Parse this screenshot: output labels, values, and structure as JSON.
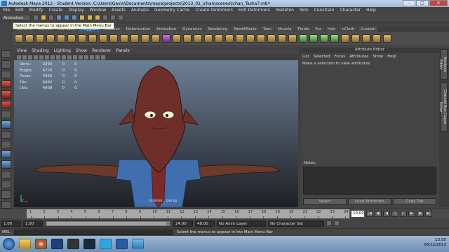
{
  "window": {
    "title": "Autodesk Maya 2012 - Student Version: C:\\Users\\Gavin\\Documents\\maya\\projects\\2013_01_ichan\\scenes\\Ichan_Tasha7.mb*"
  },
  "menubar": [
    "File",
    "Edit",
    "Modify",
    "Create",
    "Display",
    "Window",
    "Assets",
    "Animate",
    "Geometry Cache",
    "Create Deformers",
    "Edit Deformers",
    "Skeleton",
    "Skin",
    "Constrain",
    "Character",
    "Help"
  ],
  "status_line": {
    "mode": "Animation"
  },
  "tooltip": "Select the menus to appear in the Main Menu Bar",
  "shelf_tabs": [
    {
      "label": "General",
      "active": false
    },
    {
      "label": "Curves",
      "active": false
    },
    {
      "label": "Surfaces",
      "active": false
    },
    {
      "label": "Polygons",
      "active": true
    },
    {
      "label": "Subdivs",
      "active": false
    },
    {
      "label": "Deformation",
      "active": false
    },
    {
      "label": "Animation",
      "active": false
    },
    {
      "label": "Dynamics",
      "active": false
    },
    {
      "label": "Rendering",
      "active": false
    },
    {
      "label": "PaintEffects",
      "active": false
    },
    {
      "label": "Toon",
      "active": false
    },
    {
      "label": "Muscle",
      "active": false
    },
    {
      "label": "Fluids",
      "active": false
    },
    {
      "label": "Fur",
      "active": false
    },
    {
      "label": "Hair",
      "active": false
    },
    {
      "label": "nCloth",
      "active": false
    },
    {
      "label": "Custom",
      "active": false
    }
  ],
  "panel_menu": [
    "View",
    "Shading",
    "Lighting",
    "Show",
    "Renderer",
    "Panels"
  ],
  "hud": [
    {
      "label": "Verts:",
      "v1": "3290",
      "v2": "0",
      "v3": "0"
    },
    {
      "label": "Edges:",
      "v1": "6776",
      "v2": "0",
      "v3": "0"
    },
    {
      "label": "Faces:",
      "v1": "3456",
      "v2": "0",
      "v3": "0"
    },
    {
      "label": "Tris:",
      "v1": "6490",
      "v2": "0",
      "v3": "0"
    },
    {
      "label": "UVs:",
      "v1": "4008",
      "v2": "0",
      "v3": "0"
    }
  ],
  "camera_label": "rotatek : persp",
  "attribute_editor": {
    "header": "Attribute Editor",
    "menu": [
      "List",
      "Selected",
      "Focus",
      "Attributes",
      "Show",
      "Help"
    ],
    "message": "Make a selection to view attributes",
    "notes_label": "Notes:",
    "buttons": [
      "Select",
      "Load Attributes",
      "Copy Tab"
    ]
  },
  "side_tabs": [
    "Attribute Editor",
    "Channel Box / Layer Editor"
  ],
  "timeline": {
    "ticks": [
      "1",
      "2",
      "3",
      "4",
      "5",
      "6",
      "7",
      "8",
      "9",
      "10",
      "11",
      "12",
      "13",
      "14",
      "15",
      "16",
      "17",
      "18",
      "19",
      "20",
      "21",
      "22",
      "23",
      "24"
    ],
    "current_frame": "10.00"
  },
  "range": {
    "start": "1.00",
    "start2": "1.00",
    "bar_label": "1",
    "end_label": "24",
    "end": "24.00",
    "end2": "48.00",
    "anim_layer": "No Anim Layer",
    "character_set": "No Character Set"
  },
  "command_line": {
    "label": "MEL",
    "help": "Select the menus to appear in the Main Menu Bar"
  },
  "taskbar": {
    "time": "13:55",
    "date": "06/12/2013"
  },
  "colors": {
    "accent": "#2f5d8c",
    "viewport_top": "#6d7f96",
    "viewport_bottom": "#1e2024"
  }
}
